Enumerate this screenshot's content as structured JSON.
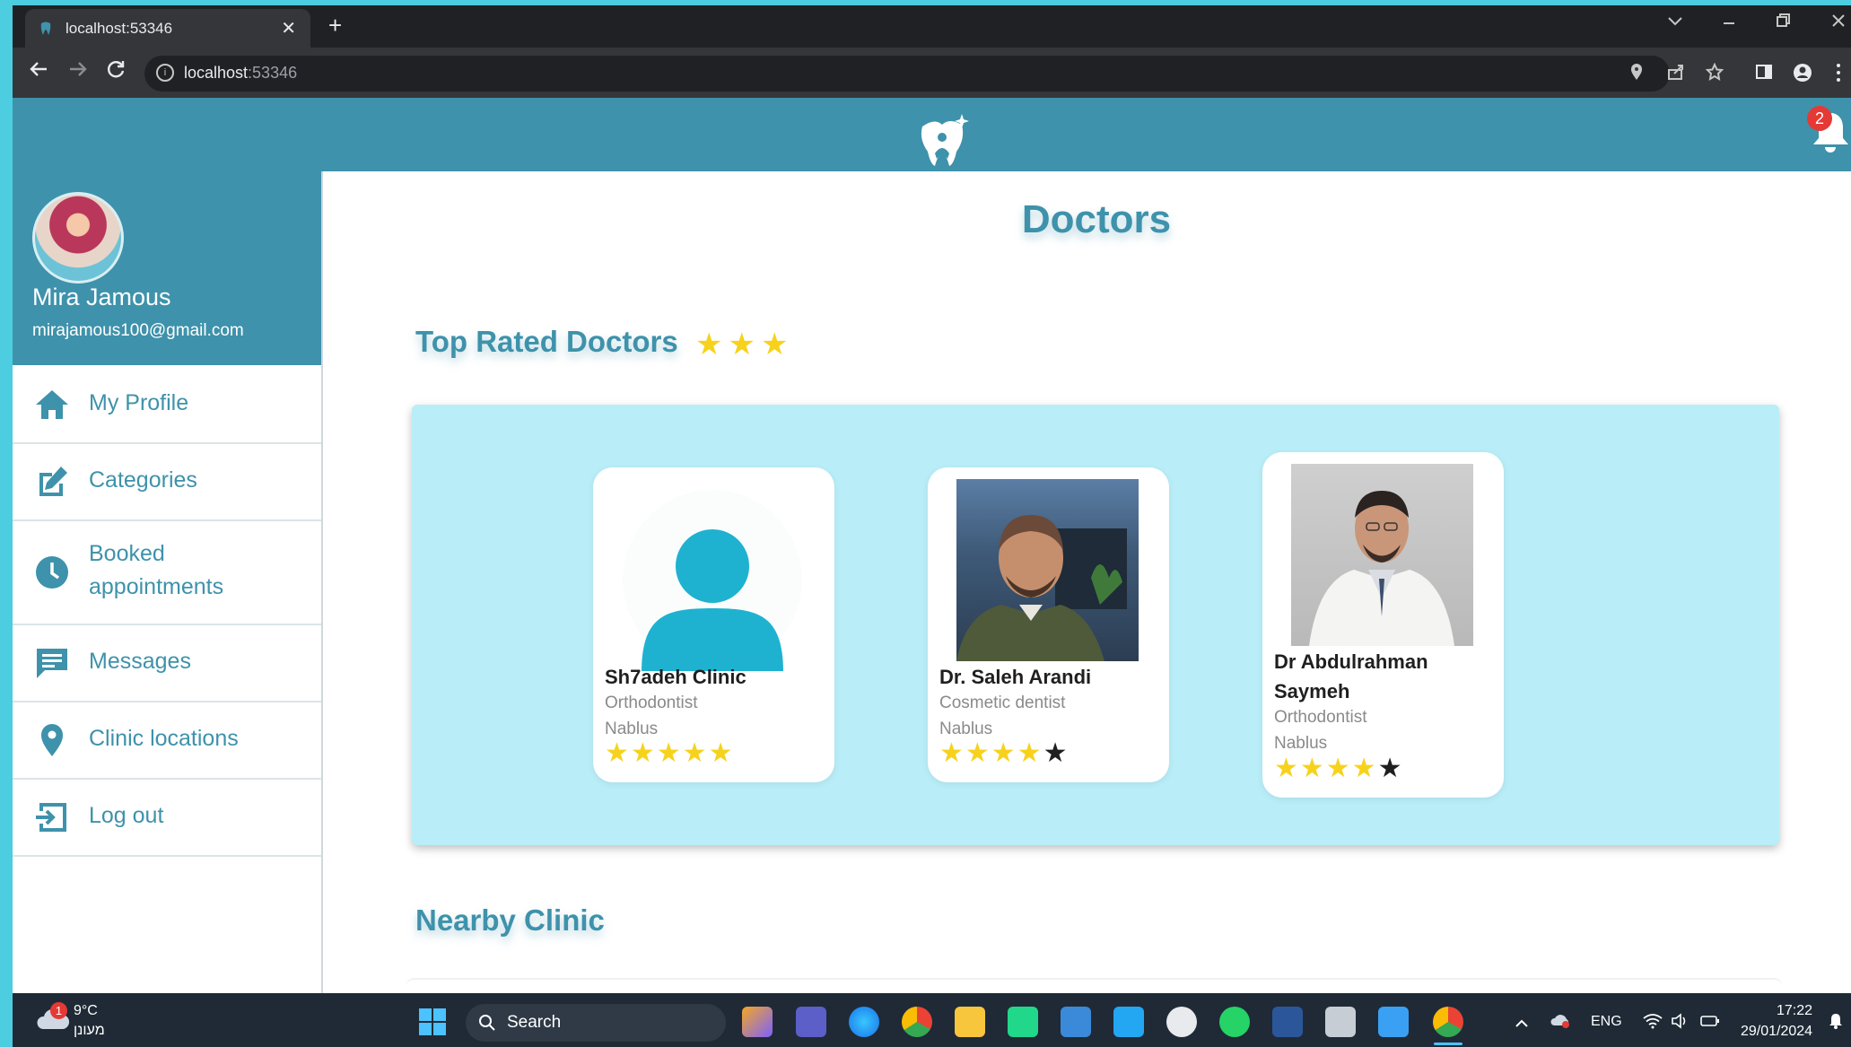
{
  "browser": {
    "tab_title": "localhost:53346",
    "tab_close": "✕",
    "new_tab": "+",
    "url_host": "localhost",
    "url_port": ":53346",
    "info_icon": "i"
  },
  "header": {
    "notification_count": "2"
  },
  "user": {
    "name": "Mira Jamous",
    "email": "mirajamous100@gmail.com"
  },
  "nav": {
    "items": [
      {
        "label": "My Profile",
        "icon": "home-icon"
      },
      {
        "label": "Categories",
        "icon": "edit-icon"
      },
      {
        "label": "Booked",
        "label2": "appointments",
        "icon": "clock-icon"
      },
      {
        "label": "Messages",
        "icon": "message-icon"
      },
      {
        "label": "Clinic locations",
        "icon": "location-pin-icon"
      },
      {
        "label": "Log out",
        "icon": "logout-icon"
      }
    ]
  },
  "main": {
    "page_title": "Doctors",
    "top_rated_title": "Top Rated Doctors",
    "top_rated_stars": "★★★",
    "nearby_title": "Nearby Clinic",
    "doctors": [
      {
        "name": "Sh7adeh Clinic",
        "specialty": "Orthodontist",
        "city": "Nablus",
        "rating": 5,
        "stars_on": "★★★★★",
        "stars_off": ""
      },
      {
        "name": "Dr. Saleh Arandi",
        "specialty": "Cosmetic dentist",
        "city": "Nablus",
        "rating": 4,
        "stars_on": "★★★★",
        "stars_off": "★"
      },
      {
        "name_line1": "Dr Abdulrahman",
        "name_line2": "Saymeh",
        "specialty": "Orthodontist",
        "city": "Nablus",
        "rating": 4,
        "stars_on": "★★★★",
        "stars_off": "★"
      }
    ]
  },
  "taskbar": {
    "weather_temp": "9°C",
    "weather_desc": "מעונן",
    "weather_badge": "1",
    "search_label": "Search",
    "language": "ENG",
    "time": "17:22",
    "date": "29/01/2024"
  },
  "colors": {
    "brand": "#3e92ab",
    "carousel_bg": "#b9eef8",
    "star": "#f7d21c",
    "badge": "#e53935"
  }
}
